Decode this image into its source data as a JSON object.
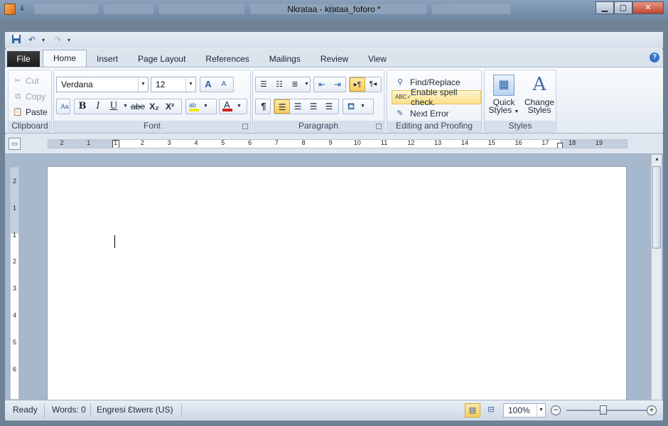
{
  "window": {
    "title": "Nkrataa - krataa_foforo *",
    "minimize_glyph": "▁",
    "maximize_glyph": "▢",
    "close_glyph": "✕"
  },
  "qat": {
    "save_icon": "save-icon",
    "undo_icon": "undo-icon",
    "redo_icon": "redo-icon"
  },
  "tabs": {
    "file": "File",
    "items": [
      "Home",
      "Insert",
      "Page Layout",
      "References",
      "Mailings",
      "Review",
      "View"
    ],
    "active": "Home",
    "help": "?"
  },
  "clipboard": {
    "label": "Clipboard",
    "cut": "Cut",
    "copy": "Copy",
    "paste": "Paste"
  },
  "font": {
    "label": "Font",
    "name": "Verdana",
    "size": "12",
    "bold": "B",
    "italic": "I",
    "underline": "U",
    "strike": "abe",
    "subscript": "X₂",
    "superscript": "X²",
    "grow": "A",
    "shrink": "A"
  },
  "paragraph": {
    "label": "Paragraph",
    "pilcrow": "¶"
  },
  "editing": {
    "label": "Editing and Proofing",
    "find_replace": "Find/Replace",
    "spell_check": "Enable spell check.",
    "next_error": "Next Error"
  },
  "styles": {
    "label": "Styles",
    "quick_styles_line1": "Quick",
    "quick_styles_line2": "Styles",
    "change_styles_line1": "Change",
    "change_styles_line2": "Styles"
  },
  "ruler": {
    "h_numbers": [
      "2",
      "1",
      "1",
      "2",
      "3",
      "4",
      "5",
      "6",
      "7",
      "8",
      "9",
      "10",
      "11",
      "12",
      "13",
      "14",
      "15",
      "16",
      "17",
      "18",
      "19"
    ],
    "v_numbers": [
      "2",
      "1",
      "1",
      "2",
      "3",
      "4",
      "5",
      "6"
    ]
  },
  "statusbar": {
    "ready": "Ready",
    "words": "Words: 0",
    "language": "Engresi Ɛtwerɛ (US)",
    "zoom": "100%",
    "zoom_out": "−",
    "zoom_in": "+"
  },
  "colors": {
    "accent": "#3574c4",
    "highlight": "#f7cd5b",
    "font_color": "#d0201b",
    "highlight_color": "#f2e600"
  }
}
